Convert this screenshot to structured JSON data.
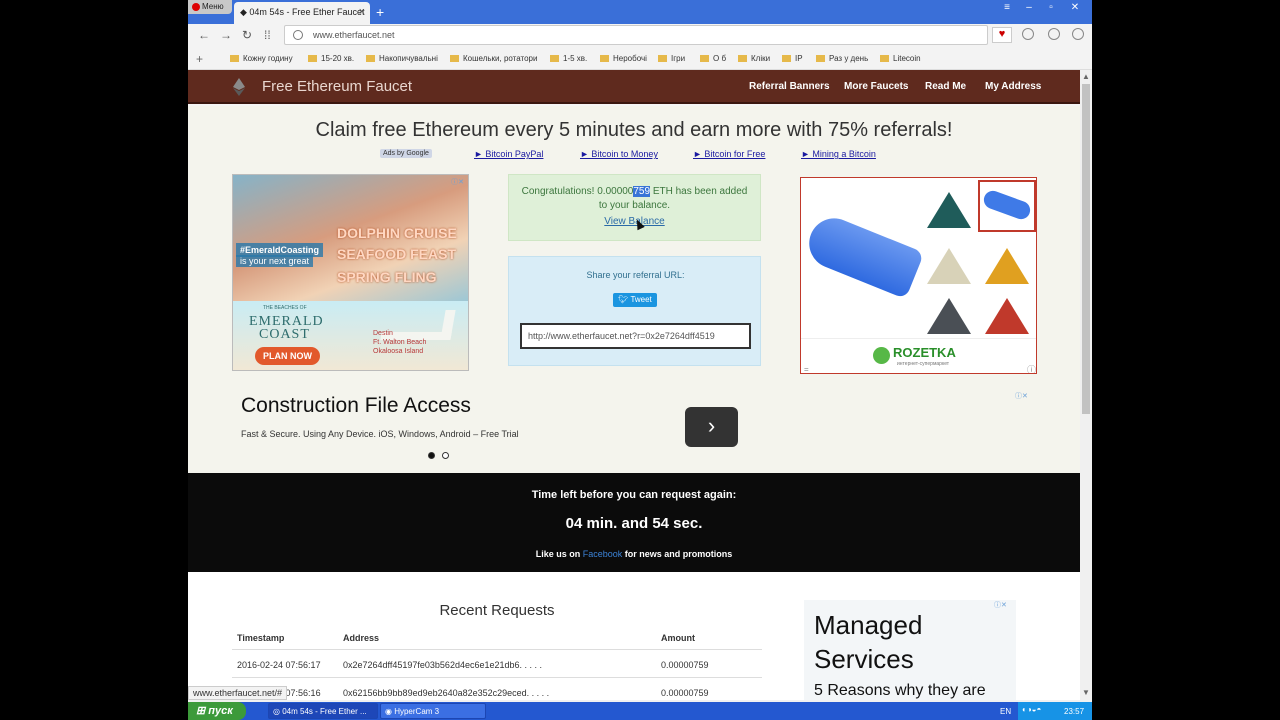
{
  "browser": {
    "menu_label": "Меню",
    "tab_title": "04m 54s - Free Ether Faucet",
    "new_tab": "+",
    "url": "www.etherfaucet.net",
    "bookmarks": [
      "Кожну годину",
      "15-20 хв.",
      "Накопичувальні",
      "Кошельки, ротатори",
      "1-5 хв.",
      "Неробочі",
      "Ігри",
      "О б",
      "Кліки",
      "IP",
      "Раз у день",
      "Litecoin"
    ],
    "status_url": "www.etherfaucet.net/#"
  },
  "nav": {
    "site_title": "Free Ethereum Faucet",
    "links": [
      "Referral Banners",
      "More Faucets",
      "Read Me",
      "My Address"
    ]
  },
  "hero": {
    "headline": "Claim free Ethereum every 5 minutes and earn more with 75% referrals!",
    "ads_by": "Ads by Google",
    "ad_links": [
      "► Bitcoin PayPal",
      "► Bitcoin to Money",
      "► Bitcoin for Free",
      "► Mining a Bitcoin"
    ]
  },
  "banner_ad": {
    "tag1": "#EmeraldCoasting",
    "tag2": "is your next great",
    "line1": "DOLPHIN CRUISE",
    "line2": "SEAFOOD FEAST",
    "line3": "SPRING FLING",
    "brand_top": "THE BEACHES OF",
    "brand1": "EMERALD",
    "brand2": "COAST",
    "places": "Destin\nFt. Walton Beach\nOkaloosa Island",
    "cta": "PLAN NOW"
  },
  "alert": {
    "text_before": "Congratulations! 0.00000",
    "text_highlight": "759",
    "text_after": " ETH has been added to your balance.",
    "link": "View Balance"
  },
  "share": {
    "label": "Share your referral URL:",
    "tweet": "Tweet",
    "referral_url": "http://www.etherfaucet.net?r=0x2e7264dff4519"
  },
  "rozetka": {
    "brand": "ROZETKA",
    "sub": "интернет-супермаркет"
  },
  "text_ad": {
    "title": "Construction File Access",
    "subtitle": "Fast & Secure. Using Any Device. iOS, Windows, Android – Free Trial",
    "arrow": "›"
  },
  "timer": {
    "label": "Time left before you can request again:",
    "time": "04 min. and 54 sec.",
    "like_before": "Like us on ",
    "facebook": "Facebook",
    "like_after": " for news and promotions"
  },
  "recent": {
    "title": "Recent Requests",
    "headers": [
      "Timestamp",
      "Address",
      "Amount"
    ],
    "rows": [
      {
        "timestamp": "2016-02-24 07:56:17",
        "address": "0x2e7264dff45197fe03b562d4ec6e1e21db6. . . . .",
        "amount": "0.00000759"
      },
      {
        "timestamp": "2016-02-24 07:56:16",
        "address": "0x62156bb9bb89ed9eb2640a82e352c29eced. . . . .",
        "amount": "0.00000759"
      }
    ]
  },
  "side_ad": {
    "heading": "Managed Services",
    "text": "5 Reasons why they are"
  },
  "taskbar": {
    "start": "пуск",
    "tasks": [
      "04m 54s - Free Ether ...",
      "HyperCam 3"
    ],
    "lang": "EN",
    "clock": "23:57"
  }
}
